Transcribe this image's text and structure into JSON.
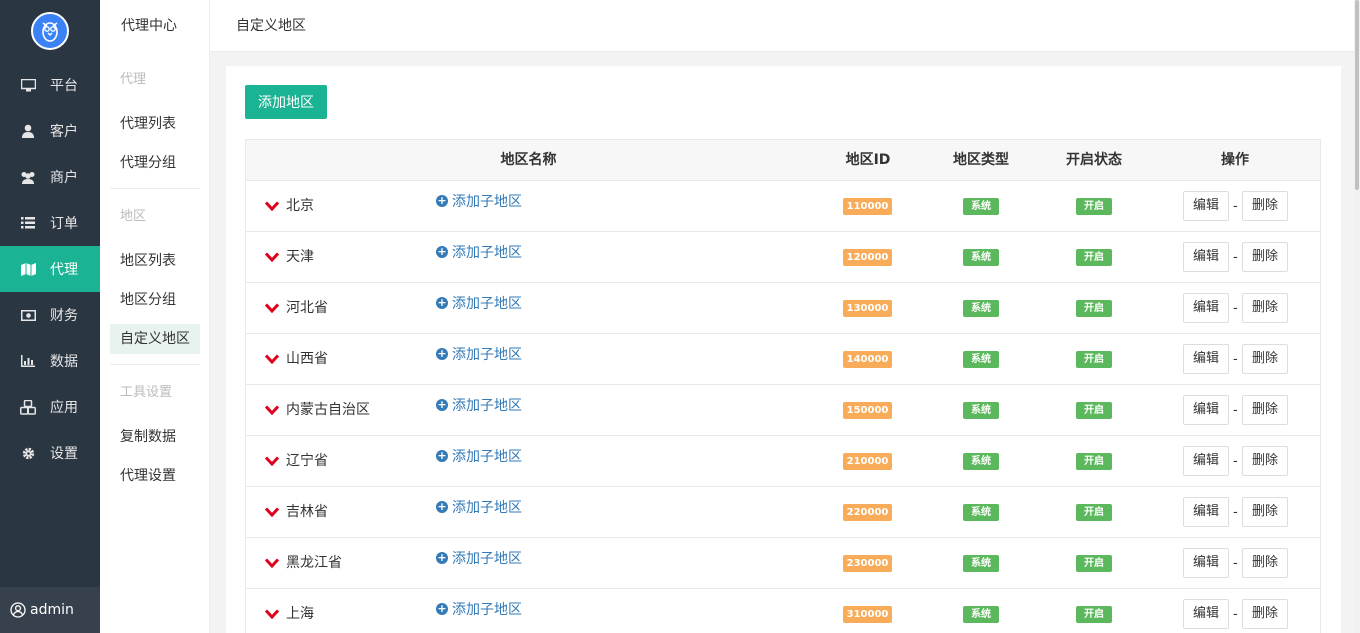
{
  "nav": {
    "items": [
      {
        "label": "平台",
        "icon": "monitor-icon"
      },
      {
        "label": "客户",
        "icon": "user-icon"
      },
      {
        "label": "商户",
        "icon": "users-icon"
      },
      {
        "label": "订单",
        "icon": "list-icon"
      },
      {
        "label": "代理",
        "icon": "map-icon",
        "active": true
      },
      {
        "label": "财务",
        "icon": "money-icon"
      },
      {
        "label": "数据",
        "icon": "bar-chart-icon"
      },
      {
        "label": "应用",
        "icon": "cubes-icon"
      },
      {
        "label": "设置",
        "icon": "gear-icon"
      }
    ],
    "user": "admin"
  },
  "subnav": {
    "head": "代理中心",
    "groups": [
      {
        "title": "代理",
        "items": [
          "代理列表",
          "代理分组"
        ]
      },
      {
        "title": "地区",
        "items": [
          "地区列表",
          "地区分组",
          "自定义地区"
        ]
      },
      {
        "title": "工具设置",
        "items": [
          "复制数据",
          "代理设置"
        ]
      }
    ],
    "active_item": "自定义地区"
  },
  "topbar": {
    "breadcrumb": "自定义地区"
  },
  "main": {
    "add_button": "添加地区",
    "columns": [
      "地区名称",
      "地区ID",
      "地区类型",
      "开启状态",
      "操作"
    ],
    "add_sub_label": "添加子地区",
    "edit_label": "编辑",
    "delete_label": "删除",
    "dash": "-",
    "rows": [
      {
        "name": "北京",
        "id": "110000",
        "type": "系统",
        "state": "开启"
      },
      {
        "name": "天津",
        "id": "120000",
        "type": "系统",
        "state": "开启"
      },
      {
        "name": "河北省",
        "id": "130000",
        "type": "系统",
        "state": "开启"
      },
      {
        "name": "山西省",
        "id": "140000",
        "type": "系统",
        "state": "开启"
      },
      {
        "name": "内蒙古自治区",
        "id": "150000",
        "type": "系统",
        "state": "开启"
      },
      {
        "name": "辽宁省",
        "id": "210000",
        "type": "系统",
        "state": "开启"
      },
      {
        "name": "吉林省",
        "id": "220000",
        "type": "系统",
        "state": "开启"
      },
      {
        "name": "黑龙江省",
        "id": "230000",
        "type": "系统",
        "state": "开启"
      },
      {
        "name": "上海",
        "id": "310000",
        "type": "系统",
        "state": "开启"
      }
    ]
  },
  "colors": {
    "accent": "#1ab394",
    "nav_bg": "#2b3643",
    "id_badge": "#f8ac59",
    "status_badge": "#5cb85c",
    "link": "#337ab7",
    "chevron": "#e0001b"
  }
}
